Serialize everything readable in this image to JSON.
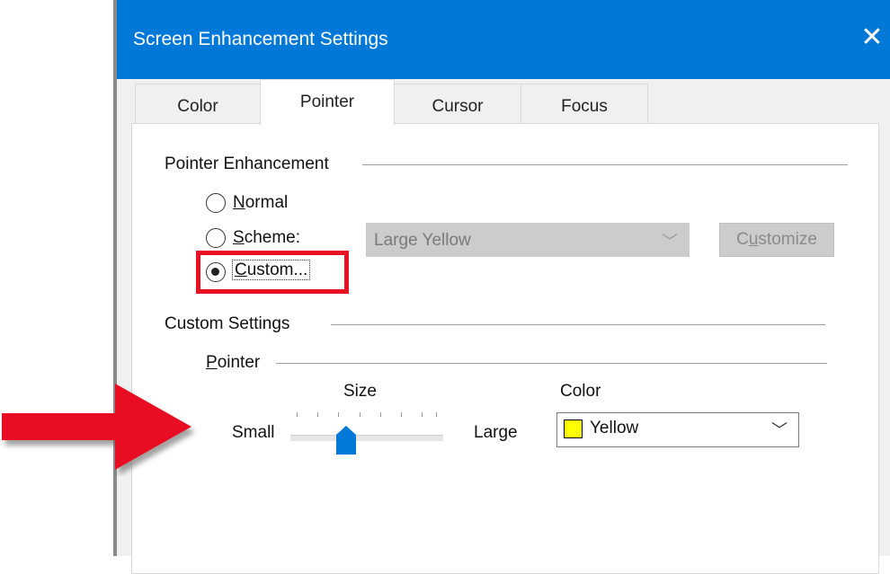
{
  "window": {
    "title": "Screen Enhancement Settings",
    "close_glyph": "✕"
  },
  "tabs": [
    {
      "label": "Color",
      "active": false
    },
    {
      "label": "Pointer",
      "active": true
    },
    {
      "label": "Cursor",
      "active": false
    },
    {
      "label": "Focus",
      "active": false
    }
  ],
  "pointer_enhancement": {
    "group_label": "Pointer Enhancement",
    "options": [
      {
        "mnemonic": "N",
        "rest": "ormal",
        "checked": false
      },
      {
        "mnemonic": "S",
        "rest": "cheme:",
        "checked": false
      },
      {
        "mnemonic": "C",
        "rest": "ustom...",
        "checked": true
      }
    ],
    "scheme_select": {
      "value": "Large Yellow",
      "disabled": true
    },
    "customize_button": {
      "mnemonic": "u",
      "pre": "C",
      "rest": "stomize",
      "disabled": true
    }
  },
  "custom_settings": {
    "group_label": "Custom Settings",
    "pointer_group": {
      "mnemonic": "P",
      "rest": "ointer"
    },
    "size": {
      "label": "Size",
      "min_label": "Small",
      "max_label": "Large",
      "level": 0.4
    },
    "color": {
      "label": "Color",
      "value": "Yellow",
      "swatch": "#ffff00"
    }
  },
  "colors": {
    "titlebar": "#0078d7",
    "highlight": "#e81123",
    "slider_thumb": "#0078d7"
  },
  "icons": {
    "close": "close-icon",
    "dropdown": "chevron-down-icon",
    "arrow": "red-arrow-annotation"
  }
}
